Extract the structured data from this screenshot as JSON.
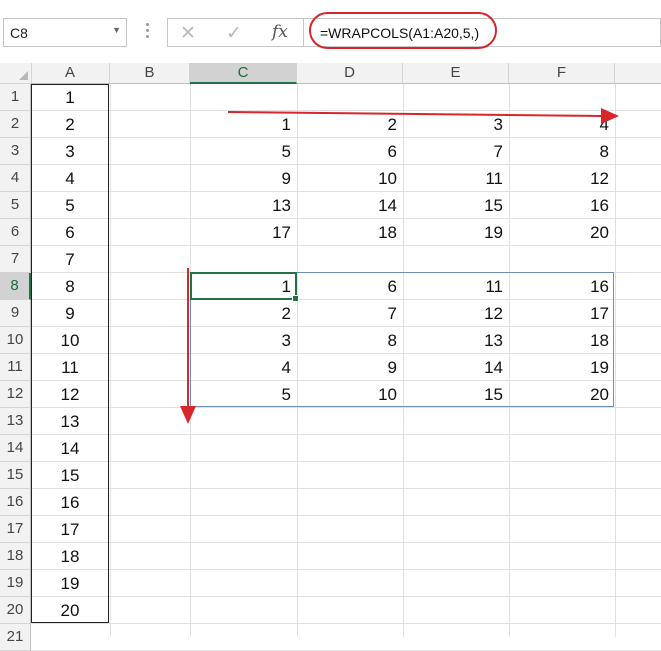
{
  "formula_bar": {
    "name_box": "C8",
    "cancel_icon": "✕",
    "enter_icon": "✓",
    "fx_label": "fx",
    "formula": "=WRAPCOLS(A1:A20,5,)"
  },
  "sheet": {
    "columns": [
      "A",
      "B",
      "C",
      "D",
      "E",
      "F"
    ],
    "selected_column": "C",
    "rows": [
      "1",
      "2",
      "3",
      "4",
      "5",
      "6",
      "7",
      "8",
      "9",
      "10",
      "11",
      "12",
      "13",
      "14",
      "15",
      "16",
      "17",
      "18",
      "19",
      "20",
      "21"
    ],
    "selected_row": "8",
    "column_a": [
      "1",
      "2",
      "3",
      "4",
      "5",
      "6",
      "7",
      "8",
      "9",
      "10",
      "11",
      "12",
      "13",
      "14",
      "15",
      "16",
      "17",
      "18",
      "19",
      "20"
    ],
    "wraprows_result": [
      [
        "1",
        "2",
        "3",
        "4"
      ],
      [
        "5",
        "6",
        "7",
        "8"
      ],
      [
        "9",
        "10",
        "11",
        "12"
      ],
      [
        "13",
        "14",
        "15",
        "16"
      ],
      [
        "17",
        "18",
        "19",
        "20"
      ]
    ],
    "wrapcols_result": [
      [
        "1",
        "6",
        "11",
        "16"
      ],
      [
        "2",
        "7",
        "12",
        "17"
      ],
      [
        "3",
        "8",
        "13",
        "18"
      ],
      [
        "4",
        "9",
        "14",
        "19"
      ],
      [
        "5",
        "10",
        "15",
        "20"
      ]
    ]
  },
  "colors": {
    "annotation_red": "#d7262c",
    "excel_green": "#217346",
    "spill_border": "#6a8fb8"
  },
  "icons": [
    "cancel-icon",
    "enter-icon",
    "fx-icon",
    "dropdown-caret-icon",
    "right-arrow-annotation",
    "down-arrow-annotation"
  ]
}
